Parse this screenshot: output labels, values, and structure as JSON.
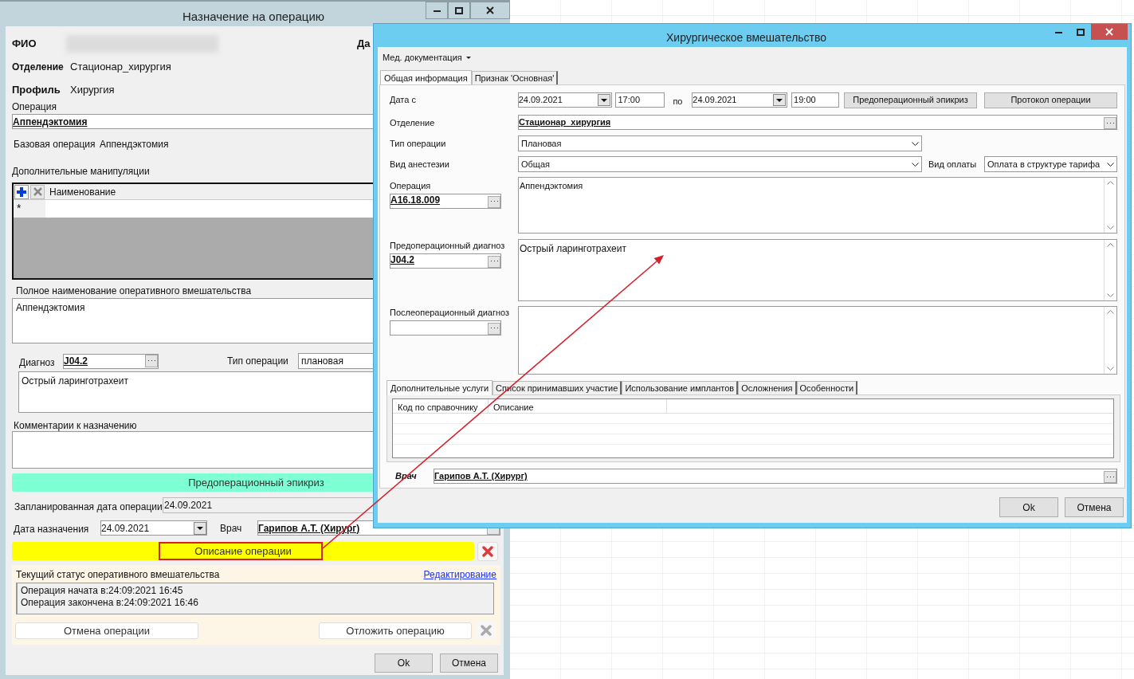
{
  "left_window": {
    "title": "Назначение на операцию",
    "patient": {
      "label": "ФИО",
      "cut_label": "Да"
    },
    "department": {
      "label": "Отделение",
      "value": "Стационар_хирургия"
    },
    "profile": {
      "label": "Профиль",
      "value": "Хирургия"
    },
    "operation": {
      "label": "Операция",
      "value": "Аппендэктомия"
    },
    "base_operation": {
      "label": "Базовая операция",
      "value": "Аппендэктомия"
    },
    "extra_manipulations": {
      "label": "Дополнительные манипуляции",
      "column": "Наименование",
      "new_row_mark": "*"
    },
    "full_name": {
      "label": "Полное наименование оперативного вмешательства",
      "value": "Аппендэктомия"
    },
    "diagnosis": {
      "label": "Диагноз",
      "code": "J04.2",
      "text": "Острый ларинготрахеит"
    },
    "operation_type": {
      "label": "Тип операции",
      "value": "плановая"
    },
    "comments": {
      "label": "Комментарии к назначению"
    },
    "epicrisis_button": "Предоперационный эпикриз",
    "planned_date": {
      "label": "Запланированная дата операции",
      "value": "24.09.2021"
    },
    "assignment_date": {
      "label": "Дата назначения",
      "value": "24.09.2021"
    },
    "doctor": {
      "label": "Врач",
      "value": "Гарипов А.Т. (Хирург)"
    },
    "description_button": "Описание операции",
    "status": {
      "label": "Текущий статус оперативного вмешательства",
      "edit_link": "Редактирование",
      "lines": [
        "Операция начата в:24:09:2021 16:45",
        "Операция закончена в:24:09:2021 16:46"
      ]
    },
    "cancel_button": "Отмена операции",
    "postpone_button": "Отложить операцию",
    "buttons": [
      "Ok",
      "Отмена"
    ]
  },
  "right_window": {
    "title": "Хирургическое вмешательство",
    "menu": "Мед. документация",
    "tabs": [
      {
        "label": "Общая информация",
        "selected": true
      },
      {
        "label": "Признак 'Основная'",
        "selected": false
      }
    ],
    "date_from": {
      "label": "Дата с",
      "date": "24.09.2021",
      "time": "17:00"
    },
    "to_label": "по",
    "date_to": {
      "date": "24.09.2021",
      "time": "19:00"
    },
    "action_buttons": [
      "Предоперационный эпикриз",
      "Протокол операции"
    ],
    "department": {
      "label": "Отделение",
      "value": "Стационар_хирургия"
    },
    "operation_type": {
      "label": "Тип операции",
      "value": "Плановая"
    },
    "anesthesia": {
      "label": "Вид анестезии",
      "value": "Общая"
    },
    "payment": {
      "label": "Вид оплаты",
      "value": "Оплата в структуре тарифа"
    },
    "operation": {
      "label": "Операция",
      "code": "A16.18.009",
      "text": "Аппендэктомия"
    },
    "preop_diagnosis": {
      "label": "Предоперационный диагноз",
      "code": "J04.2",
      "text": "Острый ларинготрахеит"
    },
    "postop_diagnosis": {
      "label": "Послеоперационный диагноз"
    },
    "bottom_tabs": [
      {
        "label": "Дополнительные услуги",
        "selected": true
      },
      {
        "label": "Список принимавших участие",
        "selected": false
      },
      {
        "label": "Использование имплантов",
        "selected": false
      },
      {
        "label": "Осложнения",
        "selected": false
      },
      {
        "label": "Особенности",
        "selected": false
      }
    ],
    "services_table": {
      "columns": [
        "Код по справочнику",
        "Описание"
      ]
    },
    "doctor": {
      "label": "Врач",
      "value": "Гарипов А.Т. (Хирург)"
    },
    "buttons": [
      "Ok",
      "Отмена"
    ]
  }
}
